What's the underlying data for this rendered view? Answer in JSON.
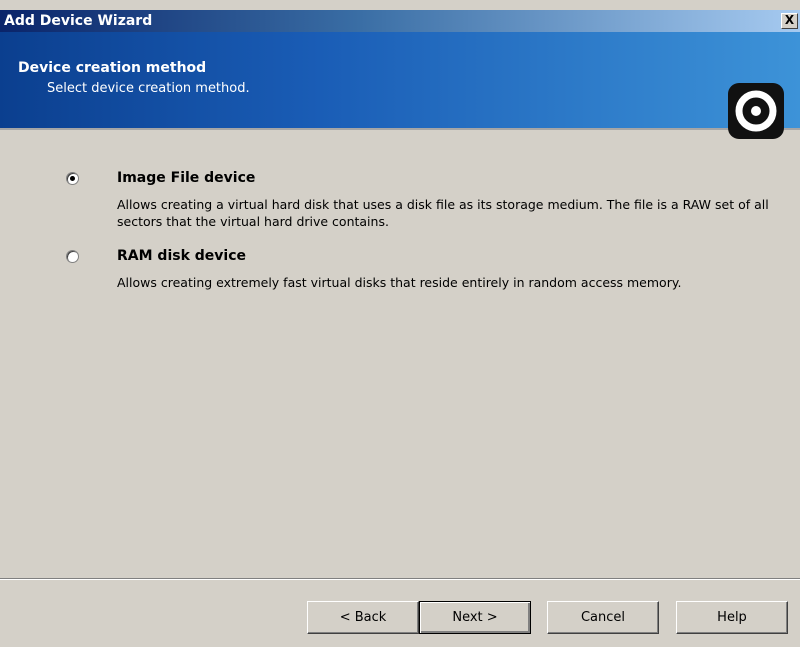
{
  "window": {
    "title": "Add Device Wizard",
    "close_label": "X"
  },
  "header": {
    "title": "Device creation method",
    "subtitle": "Select device creation method.",
    "logo_icon": "disc-icon"
  },
  "options": [
    {
      "title": "Image File device",
      "description": "Allows creating a virtual hard disk that uses a disk file as its storage medium. The file is a RAW set of all sectors that the virtual hard drive contains.",
      "selected": true
    },
    {
      "title": "RAM disk device",
      "description": "Allows creating extremely fast virtual disks that reside entirely in random access memory.",
      "selected": false
    }
  ],
  "buttons": {
    "back": "< Back",
    "next": "Next >",
    "cancel": "Cancel",
    "help": "Help"
  }
}
